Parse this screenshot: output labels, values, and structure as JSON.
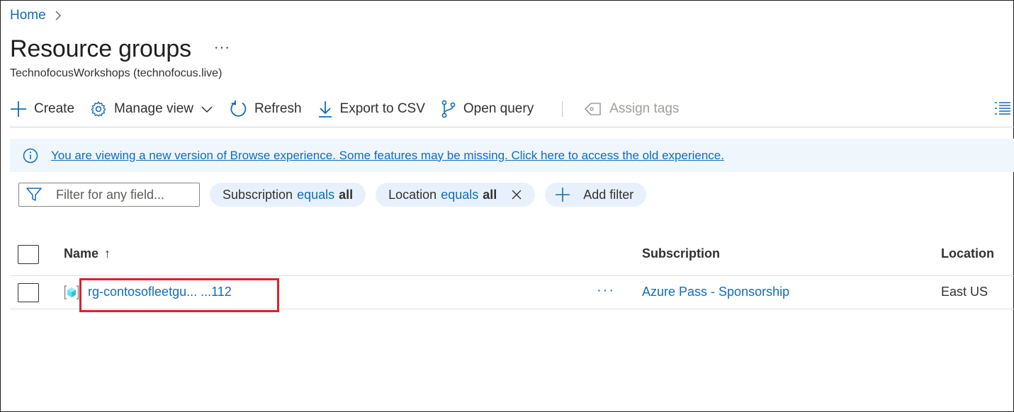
{
  "breadcrumb": {
    "home": "Home"
  },
  "header": {
    "title": "Resource groups",
    "more": "···",
    "subtitle": "TechnofocusWorkshops (technofocus.live)"
  },
  "toolbar": {
    "create": "Create",
    "manage_view": "Manage view",
    "refresh": "Refresh",
    "export_csv": "Export to CSV",
    "open_query": "Open query",
    "assign_tags": "Assign tags"
  },
  "banner": {
    "text": "You are viewing a new version of Browse experience. Some features may be missing. Click here to access the old experience."
  },
  "filters": {
    "placeholder": "Filter for any field...",
    "subscription": {
      "field": "Subscription",
      "op": "equals",
      "value": "all"
    },
    "location": {
      "field": "Location",
      "op": "equals",
      "value": "all"
    },
    "add_filter": "Add filter"
  },
  "table": {
    "columns": {
      "name": "Name",
      "sort": "↑",
      "subscription": "Subscription",
      "location": "Location"
    },
    "rows": [
      {
        "name": "rg-contosofleetgu... ...112",
        "more": "···",
        "subscription": "Azure Pass - Sponsorship",
        "location": "East US"
      }
    ]
  },
  "colors": {
    "accent": "#0f6cbd",
    "banner_bg": "#eff6fc",
    "pill_bg": "#e8f1fb",
    "highlight": "#d9232d"
  },
  "icons": [
    "chevron-right-icon",
    "plus-icon",
    "gear-icon",
    "chevron-down-icon",
    "refresh-icon",
    "download-icon",
    "branch-icon",
    "tag-icon",
    "list-view-icon",
    "info-icon",
    "funnel-icon",
    "close-icon",
    "resource-group-icon"
  ]
}
